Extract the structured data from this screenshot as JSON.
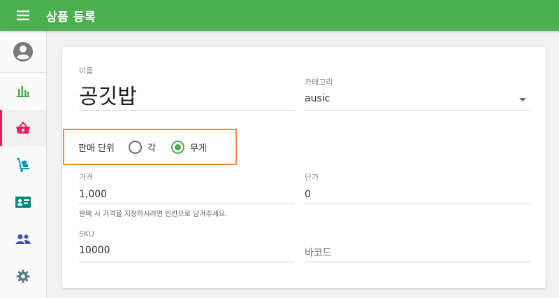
{
  "appbar": {
    "title": "상품 등록"
  },
  "sidebar": {
    "items": [
      {
        "name": "reports",
        "icon": "bar-chart-icon",
        "color": "#4caf50"
      },
      {
        "name": "items",
        "icon": "basket-icon",
        "color": "#e91e63",
        "active": true
      },
      {
        "name": "inventory",
        "icon": "dolly-icon",
        "color": "#00a0b4"
      },
      {
        "name": "customers",
        "icon": "id-card-icon",
        "color": "#00897b"
      },
      {
        "name": "employees",
        "icon": "people-icon",
        "color": "#3f51b5"
      },
      {
        "name": "settings",
        "icon": "gear-icon",
        "color": "#607d8b"
      }
    ]
  },
  "form": {
    "name": {
      "label": "이름",
      "value": "공깃밥"
    },
    "category": {
      "label": "카테고리",
      "value": "ausic"
    },
    "sell_unit": {
      "label": "판매 단위",
      "options": [
        {
          "label": "각",
          "selected": false
        },
        {
          "label": "무게",
          "selected": true
        }
      ]
    },
    "price": {
      "label": "가격",
      "value": "1,000",
      "helper": "판매 시 가격을 지정하시려면 빈칸으로 남겨주세요."
    },
    "unit_price": {
      "label": "단가",
      "value": "0"
    },
    "sku": {
      "label": "SKU",
      "value": "10000"
    },
    "barcode": {
      "placeholder": "바코드"
    }
  },
  "colors": {
    "accent": "#4caf50",
    "active": "#e91e63",
    "highlight": "#f08a4b"
  }
}
